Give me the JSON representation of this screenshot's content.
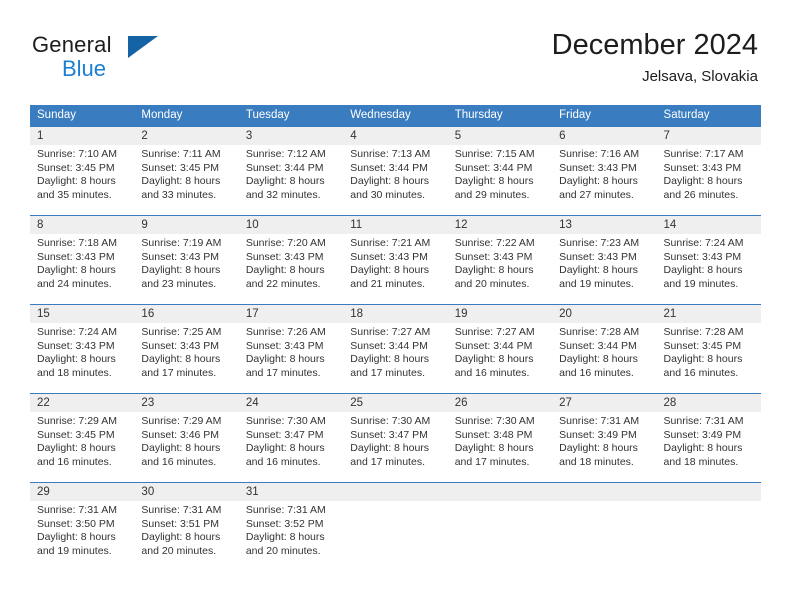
{
  "brand": {
    "name_part1": "General",
    "name_part2": "Blue",
    "logo_icon": "triangle-logo-icon",
    "accent_color": "#1c7fd4",
    "dark_color": "#1464a5"
  },
  "header": {
    "title": "December 2024",
    "subtitle": "Jelsava, Slovakia"
  },
  "theme": {
    "header_bar_color": "#3a7cc0",
    "date_band_color": "#efefef",
    "text_color": "#333333"
  },
  "calendar": {
    "weekdays": [
      "Sunday",
      "Monday",
      "Tuesday",
      "Wednesday",
      "Thursday",
      "Friday",
      "Saturday"
    ],
    "weeks": [
      {
        "days": [
          {
            "num": "1",
            "l1": "Sunrise: 7:10 AM",
            "l2": "Sunset: 3:45 PM",
            "l3": "Daylight: 8 hours",
            "l4": "and 35 minutes."
          },
          {
            "num": "2",
            "l1": "Sunrise: 7:11 AM",
            "l2": "Sunset: 3:45 PM",
            "l3": "Daylight: 8 hours",
            "l4": "and 33 minutes."
          },
          {
            "num": "3",
            "l1": "Sunrise: 7:12 AM",
            "l2": "Sunset: 3:44 PM",
            "l3": "Daylight: 8 hours",
            "l4": "and 32 minutes."
          },
          {
            "num": "4",
            "l1": "Sunrise: 7:13 AM",
            "l2": "Sunset: 3:44 PM",
            "l3": "Daylight: 8 hours",
            "l4": "and 30 minutes."
          },
          {
            "num": "5",
            "l1": "Sunrise: 7:15 AM",
            "l2": "Sunset: 3:44 PM",
            "l3": "Daylight: 8 hours",
            "l4": "and 29 minutes."
          },
          {
            "num": "6",
            "l1": "Sunrise: 7:16 AM",
            "l2": "Sunset: 3:43 PM",
            "l3": "Daylight: 8 hours",
            "l4": "and 27 minutes."
          },
          {
            "num": "7",
            "l1": "Sunrise: 7:17 AM",
            "l2": "Sunset: 3:43 PM",
            "l3": "Daylight: 8 hours",
            "l4": "and 26 minutes."
          }
        ]
      },
      {
        "days": [
          {
            "num": "8",
            "l1": "Sunrise: 7:18 AM",
            "l2": "Sunset: 3:43 PM",
            "l3": "Daylight: 8 hours",
            "l4": "and 24 minutes."
          },
          {
            "num": "9",
            "l1": "Sunrise: 7:19 AM",
            "l2": "Sunset: 3:43 PM",
            "l3": "Daylight: 8 hours",
            "l4": "and 23 minutes."
          },
          {
            "num": "10",
            "l1": "Sunrise: 7:20 AM",
            "l2": "Sunset: 3:43 PM",
            "l3": "Daylight: 8 hours",
            "l4": "and 22 minutes."
          },
          {
            "num": "11",
            "l1": "Sunrise: 7:21 AM",
            "l2": "Sunset: 3:43 PM",
            "l3": "Daylight: 8 hours",
            "l4": "and 21 minutes."
          },
          {
            "num": "12",
            "l1": "Sunrise: 7:22 AM",
            "l2": "Sunset: 3:43 PM",
            "l3": "Daylight: 8 hours",
            "l4": "and 20 minutes."
          },
          {
            "num": "13",
            "l1": "Sunrise: 7:23 AM",
            "l2": "Sunset: 3:43 PM",
            "l3": "Daylight: 8 hours",
            "l4": "and 19 minutes."
          },
          {
            "num": "14",
            "l1": "Sunrise: 7:24 AM",
            "l2": "Sunset: 3:43 PM",
            "l3": "Daylight: 8 hours",
            "l4": "and 19 minutes."
          }
        ]
      },
      {
        "days": [
          {
            "num": "15",
            "l1": "Sunrise: 7:24 AM",
            "l2": "Sunset: 3:43 PM",
            "l3": "Daylight: 8 hours",
            "l4": "and 18 minutes."
          },
          {
            "num": "16",
            "l1": "Sunrise: 7:25 AM",
            "l2": "Sunset: 3:43 PM",
            "l3": "Daylight: 8 hours",
            "l4": "and 17 minutes."
          },
          {
            "num": "17",
            "l1": "Sunrise: 7:26 AM",
            "l2": "Sunset: 3:43 PM",
            "l3": "Daylight: 8 hours",
            "l4": "and 17 minutes."
          },
          {
            "num": "18",
            "l1": "Sunrise: 7:27 AM",
            "l2": "Sunset: 3:44 PM",
            "l3": "Daylight: 8 hours",
            "l4": "and 17 minutes."
          },
          {
            "num": "19",
            "l1": "Sunrise: 7:27 AM",
            "l2": "Sunset: 3:44 PM",
            "l3": "Daylight: 8 hours",
            "l4": "and 16 minutes."
          },
          {
            "num": "20",
            "l1": "Sunrise: 7:28 AM",
            "l2": "Sunset: 3:44 PM",
            "l3": "Daylight: 8 hours",
            "l4": "and 16 minutes."
          },
          {
            "num": "21",
            "l1": "Sunrise: 7:28 AM",
            "l2": "Sunset: 3:45 PM",
            "l3": "Daylight: 8 hours",
            "l4": "and 16 minutes."
          }
        ]
      },
      {
        "days": [
          {
            "num": "22",
            "l1": "Sunrise: 7:29 AM",
            "l2": "Sunset: 3:45 PM",
            "l3": "Daylight: 8 hours",
            "l4": "and 16 minutes."
          },
          {
            "num": "23",
            "l1": "Sunrise: 7:29 AM",
            "l2": "Sunset: 3:46 PM",
            "l3": "Daylight: 8 hours",
            "l4": "and 16 minutes."
          },
          {
            "num": "24",
            "l1": "Sunrise: 7:30 AM",
            "l2": "Sunset: 3:47 PM",
            "l3": "Daylight: 8 hours",
            "l4": "and 16 minutes."
          },
          {
            "num": "25",
            "l1": "Sunrise: 7:30 AM",
            "l2": "Sunset: 3:47 PM",
            "l3": "Daylight: 8 hours",
            "l4": "and 17 minutes."
          },
          {
            "num": "26",
            "l1": "Sunrise: 7:30 AM",
            "l2": "Sunset: 3:48 PM",
            "l3": "Daylight: 8 hours",
            "l4": "and 17 minutes."
          },
          {
            "num": "27",
            "l1": "Sunrise: 7:31 AM",
            "l2": "Sunset: 3:49 PM",
            "l3": "Daylight: 8 hours",
            "l4": "and 18 minutes."
          },
          {
            "num": "28",
            "l1": "Sunrise: 7:31 AM",
            "l2": "Sunset: 3:49 PM",
            "l3": "Daylight: 8 hours",
            "l4": "and 18 minutes."
          }
        ]
      },
      {
        "days": [
          {
            "num": "29",
            "l1": "Sunrise: 7:31 AM",
            "l2": "Sunset: 3:50 PM",
            "l3": "Daylight: 8 hours",
            "l4": "and 19 minutes."
          },
          {
            "num": "30",
            "l1": "Sunrise: 7:31 AM",
            "l2": "Sunset: 3:51 PM",
            "l3": "Daylight: 8 hours",
            "l4": "and 20 minutes."
          },
          {
            "num": "31",
            "l1": "Sunrise: 7:31 AM",
            "l2": "Sunset: 3:52 PM",
            "l3": "Daylight: 8 hours",
            "l4": "and 20 minutes."
          },
          {
            "num": "",
            "l1": "",
            "l2": "",
            "l3": "",
            "l4": ""
          },
          {
            "num": "",
            "l1": "",
            "l2": "",
            "l3": "",
            "l4": ""
          },
          {
            "num": "",
            "l1": "",
            "l2": "",
            "l3": "",
            "l4": ""
          },
          {
            "num": "",
            "l1": "",
            "l2": "",
            "l3": "",
            "l4": ""
          }
        ]
      }
    ]
  }
}
